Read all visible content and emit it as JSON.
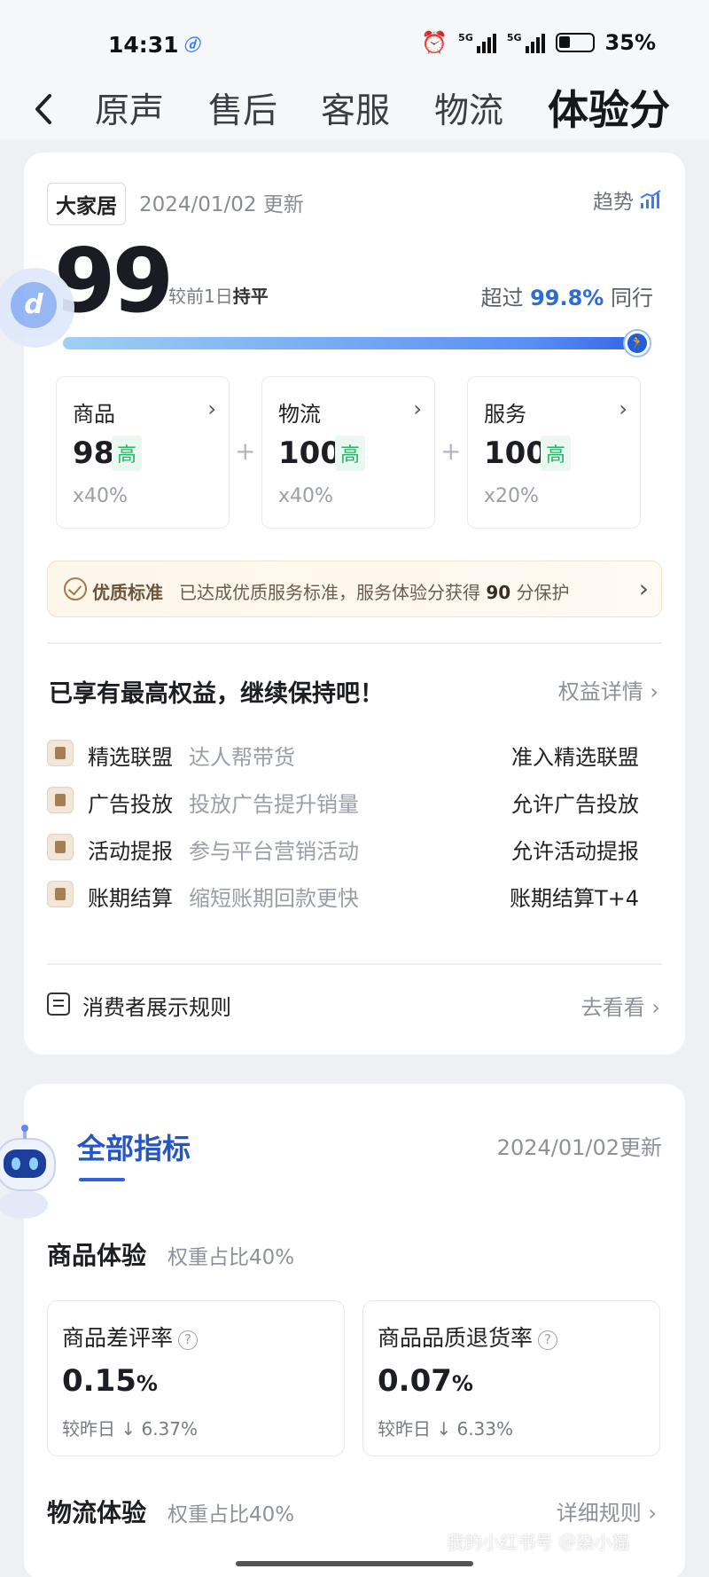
{
  "status": {
    "time": "14:31",
    "network1": "5G",
    "network2": "5G",
    "battery": "35%",
    "icons": [
      "app-icon",
      "alarm-icon",
      "signal-icon",
      "signal-icon",
      "battery-icon"
    ]
  },
  "nav": {
    "tabs": [
      "原声",
      "售后",
      "客服",
      "物流",
      "体验分"
    ],
    "active_tab": "体验分"
  },
  "summary": {
    "category": "大家居",
    "update": "2024/01/02 更新",
    "trend_label": "趋势",
    "score": "99",
    "compare_prefix": "较前1日",
    "compare_value": "持平",
    "exceed_prefix": "超过",
    "exceed_value": "99.8%",
    "exceed_suffix": "同行",
    "progress": 0.998
  },
  "subscores": [
    {
      "name": "商品",
      "value": "98",
      "level": "高",
      "weight": "x40%"
    },
    {
      "name": "物流",
      "value": "100",
      "level": "高",
      "weight": "x40%"
    },
    {
      "name": "服务",
      "value": "100",
      "level": "高",
      "weight": "x20%"
    }
  ],
  "plus_sign": "+",
  "quality": {
    "tag": "优质标准",
    "text_before": "已达成优质服务标准，服务体验分获得",
    "score": "90",
    "text_after": "分保护"
  },
  "benefits": {
    "title": "已享有最高权益，继续保持吧！",
    "link": "权益详情",
    "items": [
      {
        "name": "精选联盟",
        "desc": "达人帮带货",
        "status": "准入精选联盟"
      },
      {
        "name": "广告投放",
        "desc": "投放广告提升销量",
        "status": "允许广告投放"
      },
      {
        "name": "活动提报",
        "desc": "参与平台营销活动",
        "status": "允许活动提报"
      },
      {
        "name": "账期结算",
        "desc": "缩短账期回款更快",
        "status": "账期结算T+4"
      }
    ]
  },
  "rules": {
    "label": "消费者展示规则",
    "link": "去看看"
  },
  "indicators": {
    "title": "全部指标",
    "date": "2024/01/02更新",
    "goods_section": {
      "title": "商品体验",
      "weight": "权重占比40%"
    },
    "metrics": [
      {
        "name": "商品差评率",
        "value": "0.15",
        "unit": "%",
        "compare": "较昨日 ↓ 6.37%"
      },
      {
        "name": "商品品质退货率",
        "value": "0.07",
        "unit": "%",
        "compare": "较昨日 ↓ 6.33%"
      }
    ],
    "logistics_section": {
      "title": "物流体验",
      "weight": "权重占比40%"
    },
    "detail_link": "详细规则"
  },
  "watermark": "我的小红书号 ＠染小猫"
}
